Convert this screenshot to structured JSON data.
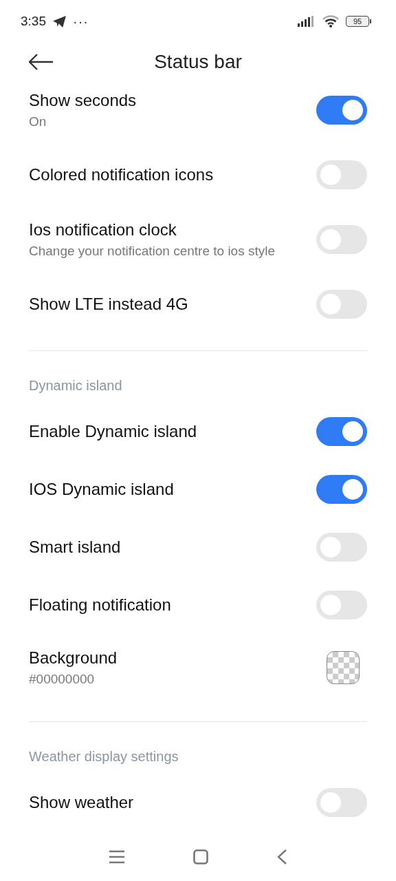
{
  "status_bar": {
    "time": "3:35",
    "dots": "···",
    "battery": "95"
  },
  "header": {
    "title": "Status bar"
  },
  "sections": [
    {
      "items": [
        {
          "kind": "switch",
          "title": "Show seconds",
          "subtitle": "On",
          "on": true
        },
        {
          "kind": "switch",
          "title": "Colored notification icons",
          "on": false
        },
        {
          "kind": "switch",
          "title": "Ios notification clock",
          "subtitle": "Change your notification centre to ios style",
          "on": false
        },
        {
          "kind": "switch",
          "title": "Show LTE instead 4G",
          "on": false
        }
      ]
    },
    {
      "header": "Dynamic island",
      "items": [
        {
          "kind": "switch",
          "title": "Enable Dynamic island",
          "on": true
        },
        {
          "kind": "switch",
          "title": "IOS Dynamic island",
          "on": true
        },
        {
          "kind": "switch",
          "title": "Smart island",
          "on": false
        },
        {
          "kind": "switch",
          "title": "Floating notification",
          "on": false
        },
        {
          "kind": "color",
          "title": "Background",
          "subtitle": "#00000000"
        }
      ]
    },
    {
      "header": "Weather display settings",
      "items": [
        {
          "kind": "switch",
          "title": "Show weather",
          "on": false
        }
      ]
    }
  ]
}
